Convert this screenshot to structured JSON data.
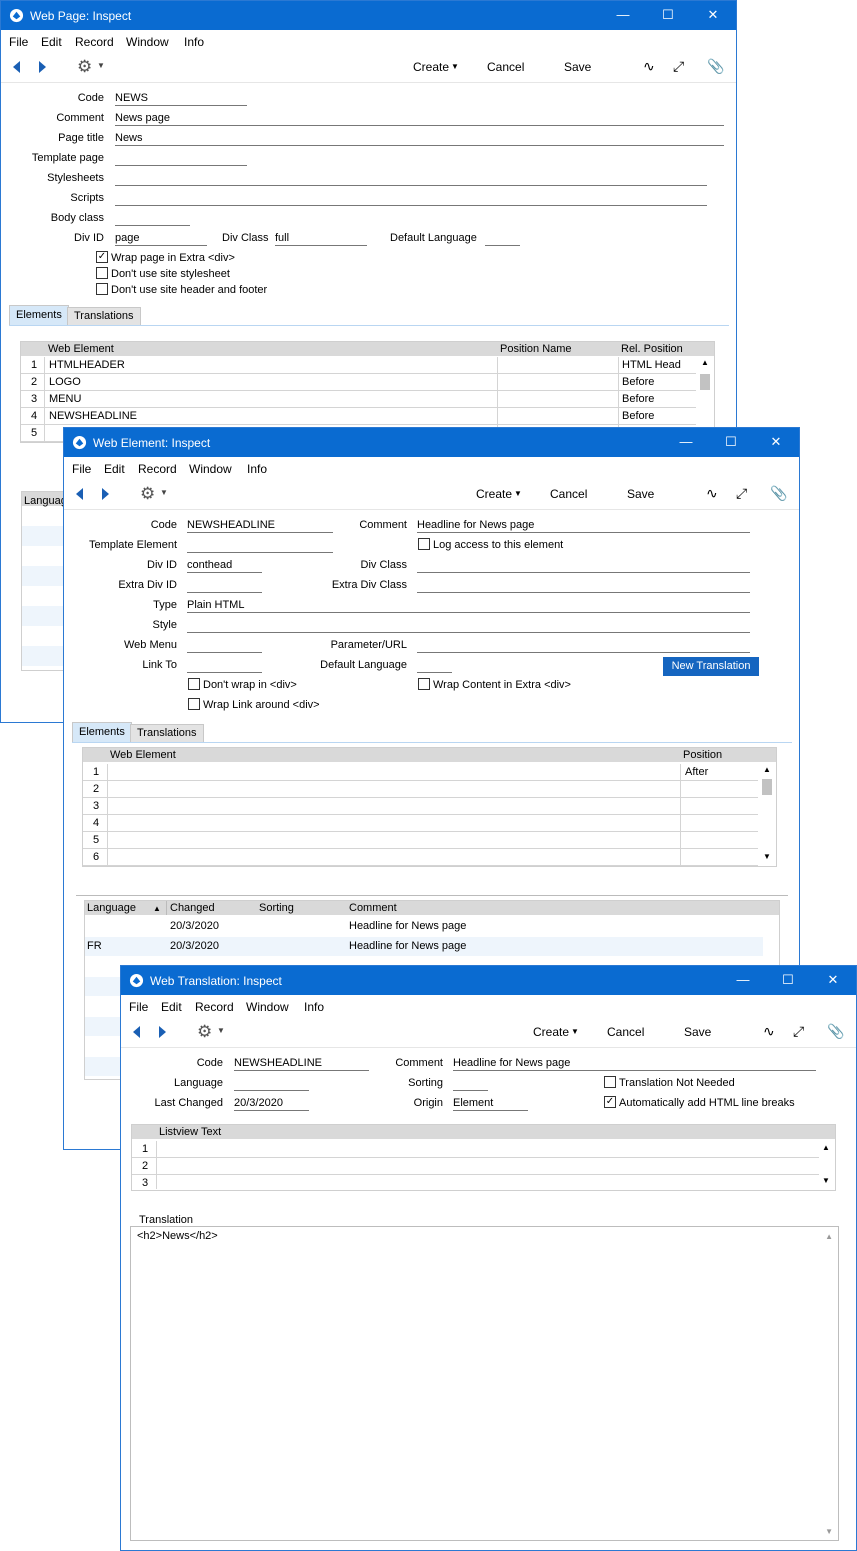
{
  "menu": [
    "File",
    "Edit",
    "Record",
    "Window",
    "Info"
  ],
  "toolbar": {
    "create": "Create",
    "cancel": "Cancel",
    "save": "Save"
  },
  "page": {
    "title": "Web Page: Inspect",
    "labels": {
      "code": "Code",
      "comment": "Comment",
      "page_title": "Page title",
      "template": "Template page",
      "stylesheets": "Stylesheets",
      "scripts": "Scripts",
      "body_class": "Body class",
      "div_id": "Div ID",
      "div_class": "Div Class",
      "default_language": "Default Language"
    },
    "values": {
      "code": "NEWS",
      "comment": "News  page",
      "page_title": "News",
      "div_id": "page",
      "div_class": "full"
    },
    "checkboxes": [
      {
        "label": "Wrap page in Extra <div>",
        "checked": true
      },
      {
        "label": "Don't use site stylesheet",
        "checked": false
      },
      {
        "label": "Don't use site header and footer",
        "checked": false
      }
    ],
    "tabs": [
      "Elements",
      "Translations"
    ],
    "grid_headers": [
      "Web Element",
      "Position Name",
      "Rel. Position"
    ],
    "rows": [
      {
        "n": "1",
        "element": "HTMLHEADER",
        "pos_name": "",
        "rel": "HTML Head"
      },
      {
        "n": "2",
        "element": "LOGO",
        "pos_name": "",
        "rel": "Before"
      },
      {
        "n": "3",
        "element": "MENU",
        "pos_name": "",
        "rel": "Before"
      },
      {
        "n": "4",
        "element": "NEWSHEADLINE",
        "pos_name": "",
        "rel": "Before"
      },
      {
        "n": "5",
        "element": "",
        "pos_name": "",
        "rel": ""
      }
    ],
    "lang_header": "Languag"
  },
  "element": {
    "title": "Web Element: Inspect",
    "labels": {
      "code": "Code",
      "comment": "Comment",
      "template": "Template Element",
      "div_id": "Div ID",
      "div_class": "Div Class",
      "extra_div_id": "Extra Div ID",
      "extra_div_class": "Extra Div Class",
      "type": "Type",
      "style": "Style",
      "web_menu": "Web Menu",
      "param_url": "Parameter/URL",
      "link_to": "Link To",
      "default_language": "Default Language"
    },
    "values": {
      "code": "NEWSHEADLINE",
      "comment": "Headline for News  page",
      "div_id": "conthead",
      "type": "Plain HTML"
    },
    "log_access": {
      "label": "Log access to this element",
      "checked": false
    },
    "checkboxes": [
      {
        "label": "Don't wrap in <div>",
        "checked": false
      },
      {
        "label": "Wrap Content in Extra <div>",
        "checked": false
      },
      {
        "label": "Wrap Link around <div>",
        "checked": false
      }
    ],
    "new_translation": "New Translation",
    "tabs": [
      "Elements",
      "Translations"
    ],
    "grid_headers": [
      "Web Element",
      "Position"
    ],
    "rows": [
      {
        "n": "1",
        "element": "",
        "pos": "After"
      },
      {
        "n": "2",
        "element": "",
        "pos": ""
      },
      {
        "n": "3",
        "element": "",
        "pos": ""
      },
      {
        "n": "4",
        "element": "",
        "pos": ""
      },
      {
        "n": "5",
        "element": "",
        "pos": ""
      },
      {
        "n": "6",
        "element": "",
        "pos": ""
      }
    ],
    "trans_headers": [
      "Language",
      "Changed",
      "Sorting",
      "Comment"
    ],
    "trans_rows": [
      {
        "lang": "",
        "changed": "20/3/2020",
        "sorting": "",
        "comment": "Headline for News  page"
      },
      {
        "lang": "FR",
        "changed": "20/3/2020",
        "sorting": "",
        "comment": "Headline for News  page"
      }
    ]
  },
  "translation": {
    "title": "Web Translation: Inspect",
    "labels": {
      "code": "Code",
      "comment": "Comment",
      "language": "Language",
      "sorting": "Sorting",
      "last_changed": "Last Changed",
      "origin": "Origin"
    },
    "values": {
      "code": "NEWSHEADLINE",
      "comment": "Headline for News  page",
      "last_changed": "20/3/2020",
      "origin": "Element"
    },
    "checkboxes": [
      {
        "label": "Translation Not Needed",
        "checked": false
      },
      {
        "label": "Automatically add HTML line breaks",
        "checked": true
      }
    ],
    "listview_header": "Listview Text",
    "listview_rows": [
      "1",
      "2",
      "3"
    ],
    "translation_label": "Translation",
    "translation_text": "<h2>News</h2>"
  }
}
